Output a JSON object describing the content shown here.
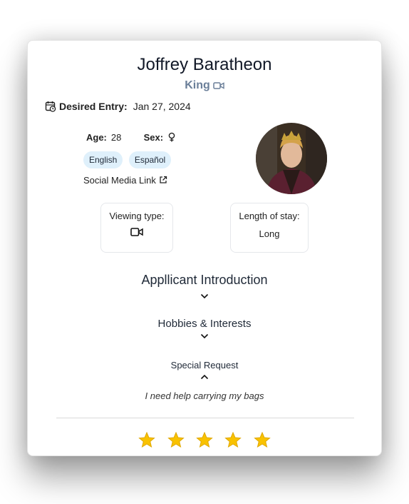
{
  "applicant": {
    "name": "Joffrey Baratheon",
    "role": "King",
    "entry_label": "Desired Entry:",
    "entry_date": "Jan 27, 2024",
    "age_label": "Age:",
    "age": "28",
    "sex_label": "Sex:",
    "languages": [
      "English",
      "Español"
    ],
    "social_link": "Social Media Link"
  },
  "viewing": {
    "label": "Viewing type:"
  },
  "stay": {
    "label": "Length of stay:",
    "value": "Long"
  },
  "sections": {
    "intro": "Appllicant Introduction",
    "hobbies": "Hobbies & Interests",
    "special": "Special Request",
    "special_text": "I need help carrying my bags"
  },
  "rating": {
    "stars": 5,
    "max": 5,
    "color": "#f9c200"
  },
  "icons": {
    "role_icon": "video-camera-icon",
    "entry_icon": "calendar-clock-icon",
    "sex_icon": "female-symbol-icon",
    "link_icon": "external-link-icon",
    "viewing_icon": "video-camera-icon"
  }
}
